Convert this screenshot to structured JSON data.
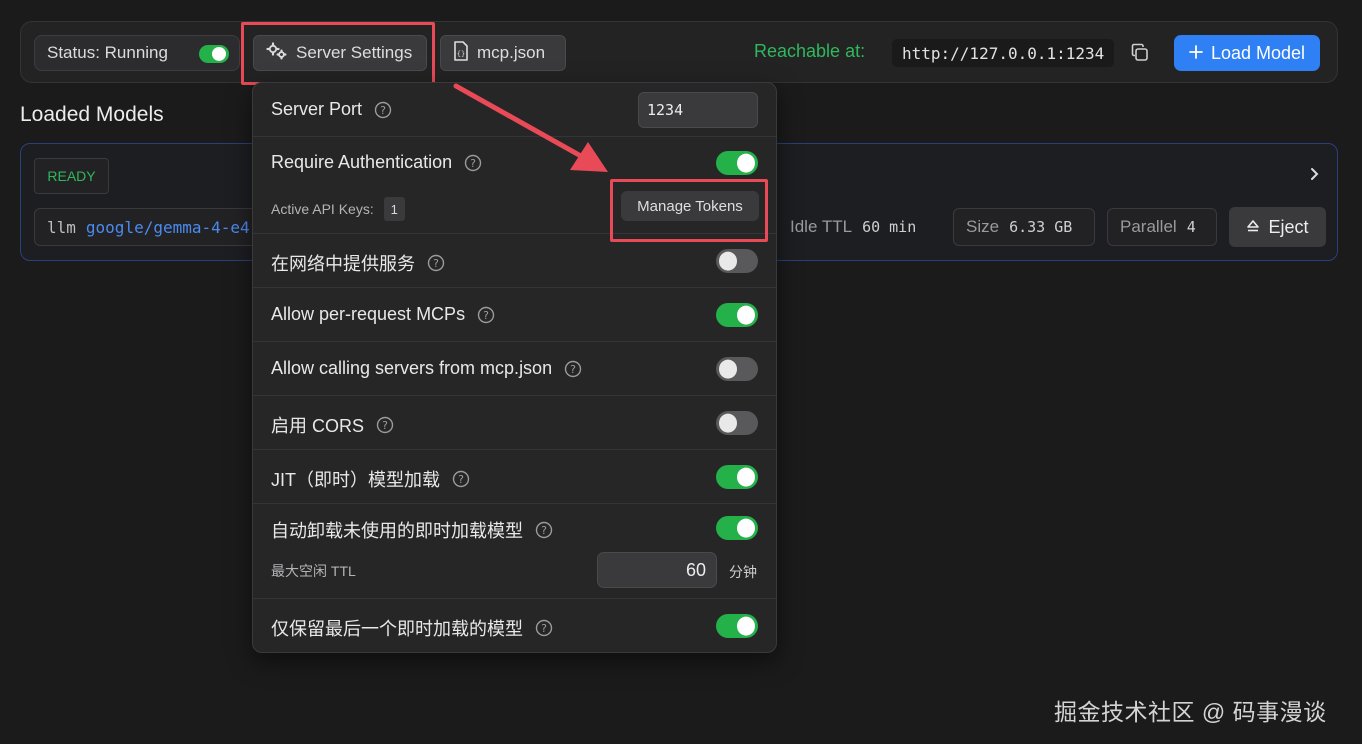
{
  "topbar": {
    "status_label": "Status: Running",
    "status_on": true,
    "server_settings_label": "Server Settings",
    "mcp_label": "mcp.json",
    "reachable_label": "Reachable at:",
    "url": "http://127.0.0.1:1234",
    "load_model_label": "Load Model"
  },
  "loaded_models": {
    "title": "Loaded Models",
    "model": {
      "badge": "READY",
      "type": "llm",
      "name": "google/gemma-4-e4",
      "idle_ttl_label": "Idle TTL",
      "idle_ttl_value": "60 min",
      "size_label": "Size",
      "size_value": "6.33 GB",
      "parallel_label": "Parallel",
      "parallel_value": "4",
      "eject_label": "Eject"
    }
  },
  "settings": {
    "server_port_label": "Server Port",
    "server_port_value": "1234",
    "require_auth_label": "Require Authentication",
    "require_auth_on": true,
    "active_keys_label": "Active API Keys:",
    "active_keys_count": "1",
    "manage_tokens_label": "Manage Tokens",
    "serve_network_label": "在网络中提供服务",
    "serve_network_on": false,
    "per_request_mcps_label": "Allow per-request MCPs",
    "per_request_mcps_on": true,
    "calling_servers_label": "Allow calling servers from mcp.json",
    "calling_servers_on": false,
    "cors_label": "启用 CORS",
    "cors_on": false,
    "jit_label": "JIT（即时）模型加载",
    "jit_on": true,
    "auto_unload_label": "自动卸载未使用的即时加载模型",
    "auto_unload_on": true,
    "max_idle_ttl_label": "最大空闲 TTL",
    "max_idle_ttl_value": "60",
    "max_idle_ttl_unit": "分钟",
    "keep_last_label": "仅保留最后一个即时加载的模型",
    "keep_last_on": true
  },
  "colors": {
    "accent_green": "#24b14a",
    "reachable_green": "#2fb85c",
    "primary_blue": "#2f7ff5",
    "annotation_red": "#e84a57"
  },
  "watermark": "掘金技术社区 @ 码事漫谈"
}
